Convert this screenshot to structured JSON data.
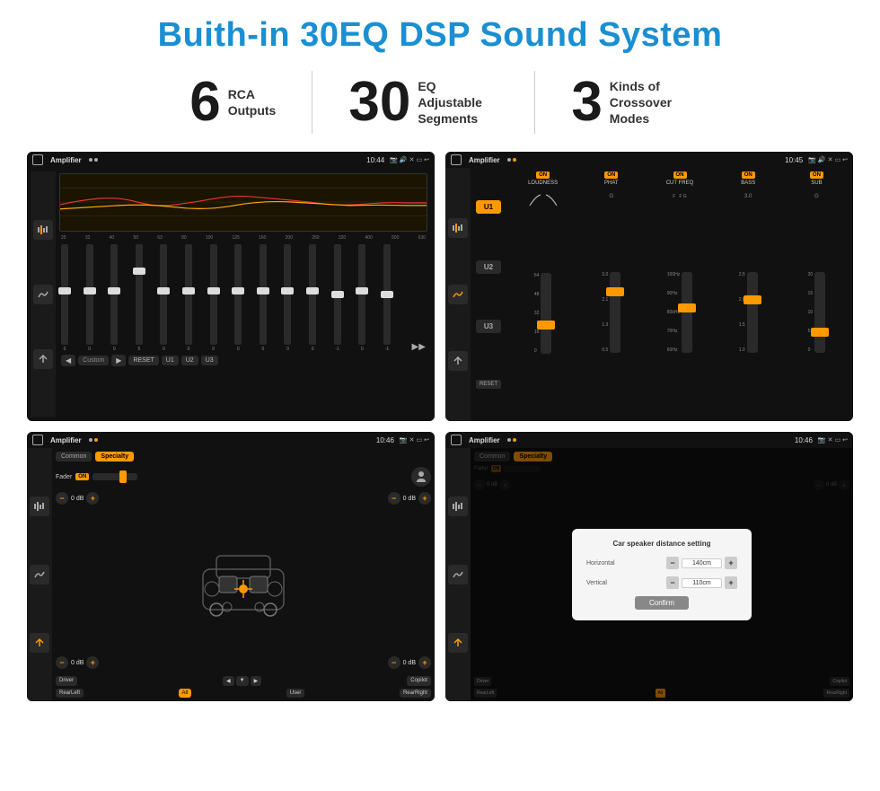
{
  "title": "Buith-in 30EQ DSP Sound System",
  "stats": [
    {
      "number": "6",
      "label": "RCA\nOutputs"
    },
    {
      "number": "30",
      "label": "EQ Adjustable\nSegments"
    },
    {
      "number": "3",
      "label": "Kinds of\nCrossover Modes"
    }
  ],
  "screens": {
    "eq": {
      "title": "Amplifier",
      "time": "10:44",
      "frequencies": [
        "25",
        "32",
        "40",
        "50",
        "63",
        "80",
        "100",
        "125",
        "160",
        "200",
        "250",
        "320",
        "400",
        "500",
        "630"
      ],
      "slider_values": [
        "0",
        "0",
        "0",
        "5",
        "0",
        "0",
        "0",
        "0",
        "0",
        "0",
        "0",
        "-1",
        "0",
        "-1"
      ],
      "buttons": [
        "Custom",
        "RESET",
        "U1",
        "U2",
        "U3"
      ]
    },
    "crossover": {
      "title": "Amplifier",
      "time": "10:45",
      "modes": [
        "U1",
        "U2",
        "U3"
      ],
      "channels": [
        "LOUDNESS",
        "PHAT",
        "CUT FREQ",
        "BASS",
        "SUB"
      ],
      "reset_label": "RESET"
    },
    "fader": {
      "title": "Amplifier",
      "time": "10:46",
      "tabs": [
        "Common",
        "Specialty"
      ],
      "fader_label": "Fader",
      "on_label": "ON",
      "buttons": [
        "Driver",
        "RearLeft",
        "All",
        "Copilot",
        "RearRight",
        "User"
      ]
    },
    "distance": {
      "title": "Amplifier",
      "time": "10:46",
      "tabs": [
        "Common",
        "Specialty"
      ],
      "dialog": {
        "title": "Car speaker distance setting",
        "horizontal_label": "Horizontal",
        "horizontal_value": "140cm",
        "vertical_label": "Vertical",
        "vertical_value": "110cm",
        "confirm_label": "Confirm"
      },
      "buttons": [
        "Driver",
        "RearLeft",
        "Copilot",
        "RearRight"
      ]
    }
  }
}
